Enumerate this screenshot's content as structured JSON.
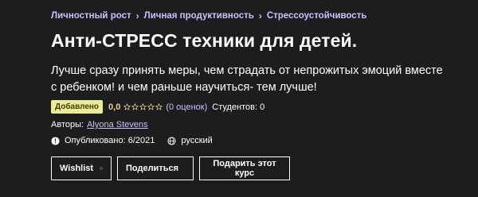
{
  "breadcrumb": {
    "items": [
      "Личностный рост",
      "Личная продуктивность",
      "Стрессоустойчивость"
    ]
  },
  "course": {
    "title": "Анти-СТРЕСС техники для детей.",
    "headline": "Лучше сразу принять меры, чем страдать от непрожитых эмоций вместе с ребенком! и чем раньше научиться- тем лучше!",
    "badge": "Добавлено",
    "rating": "0,0",
    "rating_count": "(0 оценок)",
    "students": "Студентов: 0",
    "authors_label": "Авторы:",
    "author_name": "Alyona Stevens",
    "published": "Опубликовано: 6/2021",
    "language": "русский"
  },
  "actions": {
    "wishlist_label": "Wishlist",
    "share_label": "Поделиться",
    "gift_label": "Подарить этот курс"
  },
  "icons": {
    "star": "star-outline-icon",
    "info": "alert-circle-icon",
    "language": "globe-icon",
    "wishlist": "heart-icon",
    "share": "share-arrow-icon"
  },
  "colors": {
    "background": "#1c1d1f",
    "breadcrumb": "#cec0fc",
    "badge_bg": "#eceb98",
    "rating": "#f3ca8c"
  }
}
